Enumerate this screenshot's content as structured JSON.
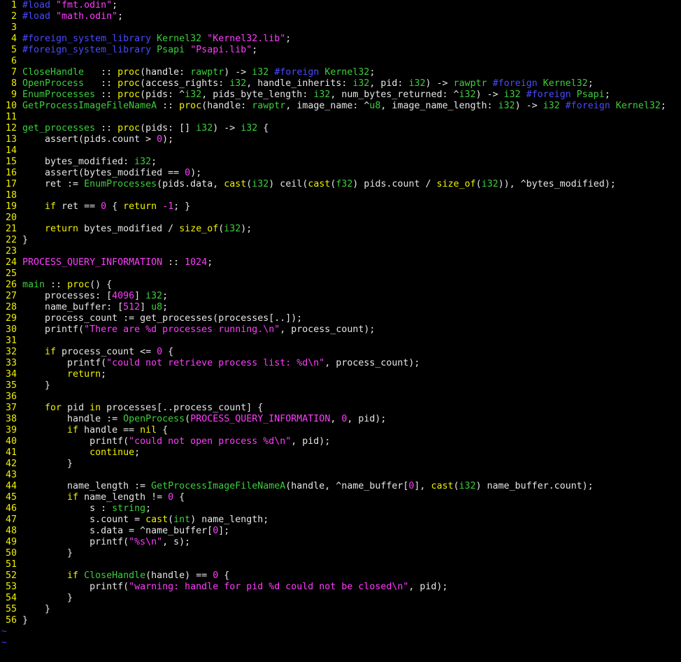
{
  "editor": {
    "lines": [
      {
        "n": "1",
        "t": [
          [
            "#load ",
            "pre"
          ],
          [
            "\"fmt.odin\"",
            "str"
          ],
          [
            ";",
            "plain"
          ]
        ]
      },
      {
        "n": "2",
        "t": [
          [
            "#load ",
            "pre"
          ],
          [
            "\"math.odin\"",
            "str"
          ],
          [
            ";",
            "plain"
          ]
        ]
      },
      {
        "n": "3",
        "t": []
      },
      {
        "n": "4",
        "t": [
          [
            "#foreign_system_library ",
            "pre"
          ],
          [
            "Kernel32 ",
            "fn"
          ],
          [
            "\"Kernel32.lib\"",
            "str"
          ],
          [
            ";",
            "plain"
          ]
        ]
      },
      {
        "n": "5",
        "t": [
          [
            "#foreign_system_library ",
            "pre"
          ],
          [
            "Psapi ",
            "fn"
          ],
          [
            "\"Psapi.lib\"",
            "str"
          ],
          [
            ";",
            "plain"
          ]
        ]
      },
      {
        "n": "6",
        "t": []
      },
      {
        "n": "7",
        "t": [
          [
            "CloseHandle",
            "fn"
          ],
          [
            "   :: ",
            "plain"
          ],
          [
            "proc",
            "kw"
          ],
          [
            "(handle: ",
            "plain"
          ],
          [
            "rawptr",
            "type"
          ],
          [
            ") -> ",
            "plain"
          ],
          [
            "i32",
            "type"
          ],
          [
            " ",
            "plain"
          ],
          [
            "#foreign ",
            "pre"
          ],
          [
            "Kernel32",
            "fn"
          ],
          [
            ";",
            "plain"
          ]
        ]
      },
      {
        "n": "8",
        "t": [
          [
            "OpenProcess",
            "fn"
          ],
          [
            "   :: ",
            "plain"
          ],
          [
            "proc",
            "kw"
          ],
          [
            "(access_rights: ",
            "plain"
          ],
          [
            "i32",
            "type"
          ],
          [
            ", handle_inherits: ",
            "plain"
          ],
          [
            "i32",
            "type"
          ],
          [
            ", pid: ",
            "plain"
          ],
          [
            "i32",
            "type"
          ],
          [
            ") -> ",
            "plain"
          ],
          [
            "rawptr",
            "type"
          ],
          [
            " ",
            "plain"
          ],
          [
            "#foreign ",
            "pre"
          ],
          [
            "Kernel32",
            "fn"
          ],
          [
            ";",
            "plain"
          ]
        ]
      },
      {
        "n": "9",
        "t": [
          [
            "EnumProcesses",
            "fn"
          ],
          [
            " :: ",
            "plain"
          ],
          [
            "proc",
            "kw"
          ],
          [
            "(pids: ^",
            "plain"
          ],
          [
            "i32",
            "type"
          ],
          [
            ", pids_byte_length: ",
            "plain"
          ],
          [
            "i32",
            "type"
          ],
          [
            ", num_bytes_returned: ^",
            "plain"
          ],
          [
            "i32",
            "type"
          ],
          [
            ") -> ",
            "plain"
          ],
          [
            "i32",
            "type"
          ],
          [
            " ",
            "plain"
          ],
          [
            "#foreign ",
            "pre"
          ],
          [
            "Psapi",
            "fn"
          ],
          [
            ";",
            "plain"
          ]
        ]
      },
      {
        "n": "10",
        "t": [
          [
            "GetProcessImageFileNameA",
            "fn"
          ],
          [
            " :: ",
            "plain"
          ],
          [
            "proc",
            "kw"
          ],
          [
            "(handle: ",
            "plain"
          ],
          [
            "rawptr",
            "type"
          ],
          [
            ", image_name: ^",
            "plain"
          ],
          [
            "u8",
            "type"
          ],
          [
            ", image_name_length: ",
            "plain"
          ],
          [
            "i32",
            "type"
          ],
          [
            ") -> ",
            "plain"
          ],
          [
            "i32",
            "type"
          ],
          [
            " ",
            "plain"
          ],
          [
            "#foreign ",
            "pre"
          ],
          [
            "Kernel32",
            "fn"
          ],
          [
            ";",
            "plain"
          ]
        ]
      },
      {
        "n": "11",
        "t": []
      },
      {
        "n": "12",
        "t": [
          [
            "get_processes",
            "fn"
          ],
          [
            " :: ",
            "plain"
          ],
          [
            "proc",
            "kw"
          ],
          [
            "(pids: [] ",
            "plain"
          ],
          [
            "i32",
            "type"
          ],
          [
            ") -> ",
            "plain"
          ],
          [
            "i32",
            "type"
          ],
          [
            " {",
            "plain"
          ]
        ]
      },
      {
        "n": "13",
        "t": [
          [
            "    assert(pids.count > ",
            "plain"
          ],
          [
            "0",
            "num"
          ],
          [
            ");",
            "plain"
          ]
        ]
      },
      {
        "n": "14",
        "t": []
      },
      {
        "n": "15",
        "t": [
          [
            "    bytes_modified: ",
            "plain"
          ],
          [
            "i32",
            "type"
          ],
          [
            ";",
            "plain"
          ]
        ]
      },
      {
        "n": "16",
        "t": [
          [
            "    assert(bytes_modified == ",
            "plain"
          ],
          [
            "0",
            "num"
          ],
          [
            ");",
            "plain"
          ]
        ]
      },
      {
        "n": "17",
        "t": [
          [
            "    ret := ",
            "plain"
          ],
          [
            "EnumProcesses",
            "fn"
          ],
          [
            "(pids.data, ",
            "plain"
          ],
          [
            "cast",
            "kw"
          ],
          [
            "(",
            "plain"
          ],
          [
            "i32",
            "type"
          ],
          [
            ") ceil(",
            "plain"
          ],
          [
            "cast",
            "kw"
          ],
          [
            "(",
            "plain"
          ],
          [
            "f32",
            "type"
          ],
          [
            ") pids.count / ",
            "plain"
          ],
          [
            "size_of",
            "kw"
          ],
          [
            "(",
            "plain"
          ],
          [
            "i32",
            "type"
          ],
          [
            ")), ^bytes_modified);",
            "plain"
          ]
        ]
      },
      {
        "n": "18",
        "t": []
      },
      {
        "n": "19",
        "t": [
          [
            "    ",
            "plain"
          ],
          [
            "if",
            "kw"
          ],
          [
            " ret == ",
            "plain"
          ],
          [
            "0",
            "num"
          ],
          [
            " { ",
            "plain"
          ],
          [
            "return",
            "kw"
          ],
          [
            " ",
            "plain"
          ],
          [
            "-1",
            "num"
          ],
          [
            "; }",
            "plain"
          ]
        ]
      },
      {
        "n": "20",
        "t": []
      },
      {
        "n": "21",
        "t": [
          [
            "    ",
            "plain"
          ],
          [
            "return",
            "kw"
          ],
          [
            " bytes_modified / ",
            "plain"
          ],
          [
            "size_of",
            "kw"
          ],
          [
            "(",
            "plain"
          ],
          [
            "i32",
            "type"
          ],
          [
            ");",
            "plain"
          ]
        ]
      },
      {
        "n": "22",
        "t": [
          [
            "}",
            "plain"
          ]
        ]
      },
      {
        "n": "23",
        "t": []
      },
      {
        "n": "24",
        "t": [
          [
            "PROCESS_QUERY_INFORMATION",
            "const"
          ],
          [
            " :: ",
            "plain"
          ],
          [
            "1024",
            "num"
          ],
          [
            ";",
            "plain"
          ]
        ]
      },
      {
        "n": "25",
        "t": []
      },
      {
        "n": "26",
        "t": [
          [
            "main",
            "fn"
          ],
          [
            " :: ",
            "plain"
          ],
          [
            "proc",
            "kw"
          ],
          [
            "() {",
            "plain"
          ]
        ]
      },
      {
        "n": "27",
        "t": [
          [
            "    processes: [",
            "plain"
          ],
          [
            "4096",
            "num"
          ],
          [
            "] ",
            "plain"
          ],
          [
            "i32",
            "type"
          ],
          [
            ";",
            "plain"
          ]
        ]
      },
      {
        "n": "28",
        "t": [
          [
            "    name_buffer: [",
            "plain"
          ],
          [
            "512",
            "num"
          ],
          [
            "] ",
            "plain"
          ],
          [
            "u8",
            "type"
          ],
          [
            ";",
            "plain"
          ]
        ]
      },
      {
        "n": "29",
        "t": [
          [
            "    process_count := get_processes(processes[..]);",
            "plain"
          ]
        ]
      },
      {
        "n": "30",
        "t": [
          [
            "    printf(",
            "plain"
          ],
          [
            "\"There are %d processes running.\\n\"",
            "str"
          ],
          [
            ", process_count);",
            "plain"
          ]
        ]
      },
      {
        "n": "31",
        "t": []
      },
      {
        "n": "32",
        "t": [
          [
            "    ",
            "plain"
          ],
          [
            "if",
            "kw"
          ],
          [
            " process_count <= ",
            "plain"
          ],
          [
            "0",
            "num"
          ],
          [
            " {",
            "plain"
          ]
        ]
      },
      {
        "n": "33",
        "t": [
          [
            "        printf(",
            "plain"
          ],
          [
            "\"could not retrieve process list: %d\\n\"",
            "str"
          ],
          [
            ", process_count);",
            "plain"
          ]
        ]
      },
      {
        "n": "34",
        "t": [
          [
            "        ",
            "plain"
          ],
          [
            "return",
            "kw"
          ],
          [
            ";",
            "plain"
          ]
        ]
      },
      {
        "n": "35",
        "t": [
          [
            "    }",
            "plain"
          ]
        ]
      },
      {
        "n": "36",
        "t": []
      },
      {
        "n": "37",
        "t": [
          [
            "    ",
            "plain"
          ],
          [
            "for",
            "kw"
          ],
          [
            " pid ",
            "plain"
          ],
          [
            "in",
            "kw"
          ],
          [
            " processes[..process_count] {",
            "plain"
          ]
        ]
      },
      {
        "n": "38",
        "t": [
          [
            "        handle := ",
            "plain"
          ],
          [
            "OpenProcess",
            "fn"
          ],
          [
            "(",
            "plain"
          ],
          [
            "PROCESS_QUERY_INFORMATION",
            "const"
          ],
          [
            ", ",
            "plain"
          ],
          [
            "0",
            "num"
          ],
          [
            ", pid);",
            "plain"
          ]
        ]
      },
      {
        "n": "39",
        "t": [
          [
            "        ",
            "plain"
          ],
          [
            "if",
            "kw"
          ],
          [
            " handle == ",
            "plain"
          ],
          [
            "nil",
            "kw"
          ],
          [
            " {",
            "plain"
          ]
        ]
      },
      {
        "n": "40",
        "t": [
          [
            "            printf(",
            "plain"
          ],
          [
            "\"could not open process %d\\n\"",
            "str"
          ],
          [
            ", pid);",
            "plain"
          ]
        ]
      },
      {
        "n": "41",
        "t": [
          [
            "            ",
            "plain"
          ],
          [
            "continue",
            "kw"
          ],
          [
            ";",
            "plain"
          ]
        ]
      },
      {
        "n": "42",
        "t": [
          [
            "        }",
            "plain"
          ]
        ]
      },
      {
        "n": "43",
        "t": []
      },
      {
        "n": "44",
        "t": [
          [
            "        name_length := ",
            "plain"
          ],
          [
            "GetProcessImageFileNameA",
            "fn"
          ],
          [
            "(handle, ^name_buffer[",
            "plain"
          ],
          [
            "0",
            "num"
          ],
          [
            "], ",
            "plain"
          ],
          [
            "cast",
            "kw"
          ],
          [
            "(",
            "plain"
          ],
          [
            "i32",
            "type"
          ],
          [
            ") name_buffer.count);",
            "plain"
          ]
        ]
      },
      {
        "n": "45",
        "t": [
          [
            "        ",
            "plain"
          ],
          [
            "if",
            "kw"
          ],
          [
            " name_length != ",
            "plain"
          ],
          [
            "0",
            "num"
          ],
          [
            " {",
            "plain"
          ]
        ]
      },
      {
        "n": "46",
        "t": [
          [
            "            s : ",
            "plain"
          ],
          [
            "string",
            "type"
          ],
          [
            ";",
            "plain"
          ]
        ]
      },
      {
        "n": "47",
        "t": [
          [
            "            s.count = ",
            "plain"
          ],
          [
            "cast",
            "kw"
          ],
          [
            "(",
            "plain"
          ],
          [
            "int",
            "type"
          ],
          [
            ") name_length;",
            "plain"
          ]
        ]
      },
      {
        "n": "48",
        "t": [
          [
            "            s.data = ^name_buffer[",
            "plain"
          ],
          [
            "0",
            "num"
          ],
          [
            "];",
            "plain"
          ]
        ]
      },
      {
        "n": "49",
        "t": [
          [
            "            printf(",
            "plain"
          ],
          [
            "\"%s\\n\"",
            "str"
          ],
          [
            ", s);",
            "plain"
          ]
        ]
      },
      {
        "n": "50",
        "t": [
          [
            "        }",
            "plain"
          ]
        ]
      },
      {
        "n": "51",
        "t": []
      },
      {
        "n": "52",
        "t": [
          [
            "        ",
            "plain"
          ],
          [
            "if",
            "kw"
          ],
          [
            " ",
            "plain"
          ],
          [
            "CloseHandle",
            "fn"
          ],
          [
            "(handle) == ",
            "plain"
          ],
          [
            "0",
            "num"
          ],
          [
            " {",
            "plain"
          ]
        ]
      },
      {
        "n": "53",
        "t": [
          [
            "            printf(",
            "plain"
          ],
          [
            "\"warning: handle for pid %d could not be closed\\n\"",
            "str"
          ],
          [
            ", pid);",
            "plain"
          ]
        ]
      },
      {
        "n": "54",
        "t": [
          [
            "        }",
            "plain"
          ]
        ]
      },
      {
        "n": "55",
        "t": [
          [
            "    }",
            "plain"
          ]
        ]
      },
      {
        "n": "56",
        "t": [
          [
            "}",
            "plain"
          ]
        ]
      }
    ],
    "tildes": [
      "~",
      "~"
    ],
    "colors": {
      "background": "#000000",
      "line_number": "#f0f000",
      "preprocessor": "#4a4aff",
      "string": "#ff3cff",
      "type": "#3ccf3c",
      "keyword": "#f0f000",
      "plain": "#e6e6e6",
      "tilde": "#3c3cff"
    }
  }
}
